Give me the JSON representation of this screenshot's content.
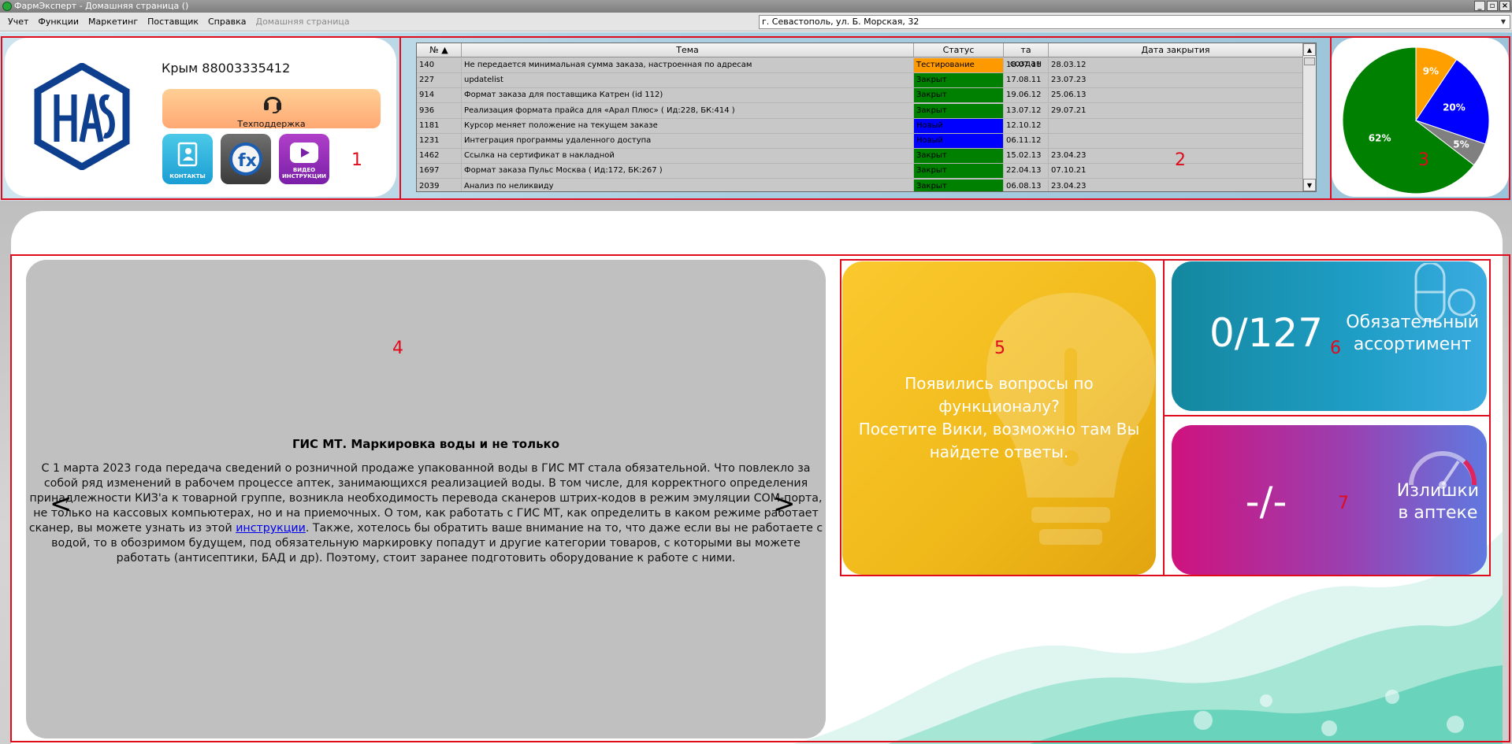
{
  "window": {
    "title": "ФармЭксперт - Домашняя страница ()",
    "buttons": [
      "_",
      "▫",
      "×"
    ]
  },
  "menu": {
    "items": [
      "Учет",
      "Функции",
      "Маркетинг",
      "Поставщик",
      "Справка"
    ],
    "disabled_item": "Домашняя страница"
  },
  "address": "г. Севастополь, ул. Б. Морская, 32",
  "contact": {
    "phone": "Крым 88003335412",
    "support_label": "Техподдержка",
    "tiles": [
      "КОНТАКТЫ",
      "",
      "ВИДЕО ИНСТРУКЦИИ"
    ]
  },
  "tickets": {
    "headers": [
      "№",
      "Тема",
      "Статус",
      "та создан",
      "Дата закрытия"
    ],
    "rows": [
      {
        "id": "140",
        "topic": "Не передается минимальная сумма заказа, настроенная по адресам",
        "status": "Тестирование",
        "created": "18.07.11",
        "closed": "28.03.12"
      },
      {
        "id": "227",
        "topic": "updatelist",
        "status": "Закрыт",
        "created": "17.08.11",
        "closed": "23.07.23"
      },
      {
        "id": "914",
        "topic": "Формат заказа для поставщика Катрен (id 112)",
        "status": "Закрыт",
        "created": "19.06.12",
        "closed": "25.06.13"
      },
      {
        "id": "936",
        "topic": "Реализация формата прайса для «Арал Плюс» ( Ид:228, БК:414 )",
        "status": "Закрыт",
        "created": "13.07.12",
        "closed": "29.07.21"
      },
      {
        "id": "1181",
        "topic": "Курсор меняет положение на текущем заказе",
        "status": "Новый",
        "created": "12.10.12",
        "closed": ""
      },
      {
        "id": "1231",
        "topic": "Интеграция программы удаленного доступа",
        "status": "Новый",
        "created": "06.11.12",
        "closed": ""
      },
      {
        "id": "1462",
        "topic": "Ссылка на сертификат в накладной",
        "status": "Закрыт",
        "created": "15.02.13",
        "closed": "23.04.23"
      },
      {
        "id": "1697",
        "topic": "Формат заказа Пульс Москва ( Ид:172, БК:267 )",
        "status": "Закрыт",
        "created": "22.04.13",
        "closed": "07.10.21"
      },
      {
        "id": "2039",
        "topic": "Анализ по неликвиду",
        "status": "Закрыт",
        "created": "06.08.13",
        "closed": "23.04.23"
      }
    ],
    "status_colors": {
      "Тестирование": "#ff9900",
      "Закрыт": "#008000",
      "Новый": "#0000ff"
    }
  },
  "chart_data": {
    "type": "pie",
    "slices": [
      {
        "value": 62,
        "label": "62%",
        "color": "#008000"
      },
      {
        "value": 9,
        "label": "9%",
        "color": "#ff9f00"
      },
      {
        "value": 20,
        "label": "20%",
        "color": "#0000ff"
      },
      {
        "value": 5,
        "label": "5%",
        "color": "#808080"
      }
    ]
  },
  "news": {
    "title": "ГИС МТ. Маркировка воды и не только",
    "body_part1": "С 1 марта 2023 года передача сведений о розничной продаже упакованной воды в ГИС МТ стала обязательной. Что повлекло за собой ряд изменений в рабочем процессе аптек, занимающихся реализацией воды. В том числе, для корректного определения принадлежности КИЗ'а к товарной группе, возникла необходимость перевода сканеров штрих-кодов в режим эмуляции COM-порта, не только на кассовых компьютерах, но и на приемочных. О том, как работать с ГИС МТ, как определить в каком режиме работает сканер, вы можете узнать из этой ",
    "link": "инструкции",
    "body_part2": ". Также, хотелось бы обратить ваше внимание на то, что даже если вы не работаете с водой, то в обозримом будущем, под обязательную маркировку попадут и другие категории товаров, с которыми вы можете работать (антисептики, БАД и др). Поэтому, стоит заранее подготовить оборудование к работе с ними.",
    "prev": "<",
    "next": ">"
  },
  "wiki": {
    "line1": "Появились вопросы по",
    "line2": "функционалу?",
    "line3": "Посетите Вики, возможно там Вы",
    "line4": "найдете ответы."
  },
  "assortment": {
    "value": "0/127",
    "label1": "Обязательный",
    "label2": "ассортимент"
  },
  "surplus": {
    "value": "-/-",
    "label1": "Излишки",
    "label2": "в аптеке"
  },
  "area_numbers": [
    "1",
    "2",
    "3",
    "4",
    "5",
    "6",
    "7"
  ]
}
